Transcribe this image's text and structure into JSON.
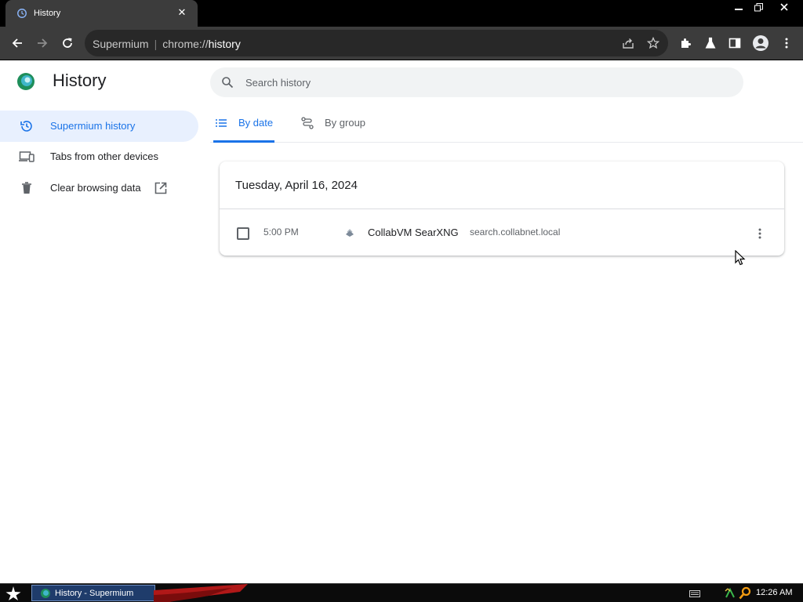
{
  "browser": {
    "tab_title": "History",
    "tab_close_icon": "close-icon",
    "omnibox": {
      "site_name": "Supermium",
      "url_prefix": "chrome://",
      "url_path": "history"
    }
  },
  "page": {
    "title": "History",
    "search": {
      "placeholder": "Search history"
    }
  },
  "sidebar": {
    "items": [
      {
        "label": "Supermium history",
        "icon": "history-icon",
        "selected": true
      },
      {
        "label": "Tabs from other devices",
        "icon": "devices-icon"
      },
      {
        "label": "Clear browsing data",
        "icon": "trash-icon",
        "trailing_icon": "open-in-new-icon"
      }
    ]
  },
  "view_tabs": [
    {
      "label": "By date",
      "icon": "list-icon",
      "selected": true
    },
    {
      "label": "By group",
      "icon": "journeys-icon"
    }
  ],
  "history": {
    "groups": [
      {
        "date": "Tuesday, April 16, 2024",
        "entries": [
          {
            "time": "5:00 PM",
            "title": "CollabVM SearXNG",
            "domain": "search.collabnet.local"
          }
        ]
      }
    ]
  },
  "taskbar": {
    "task_label": "History - Supermium",
    "clock": "12:26 AM"
  },
  "colors": {
    "accent": "#1a73e8",
    "selected_bg": "#e8f0fe",
    "chrome_dark": "#3c3c3c"
  }
}
